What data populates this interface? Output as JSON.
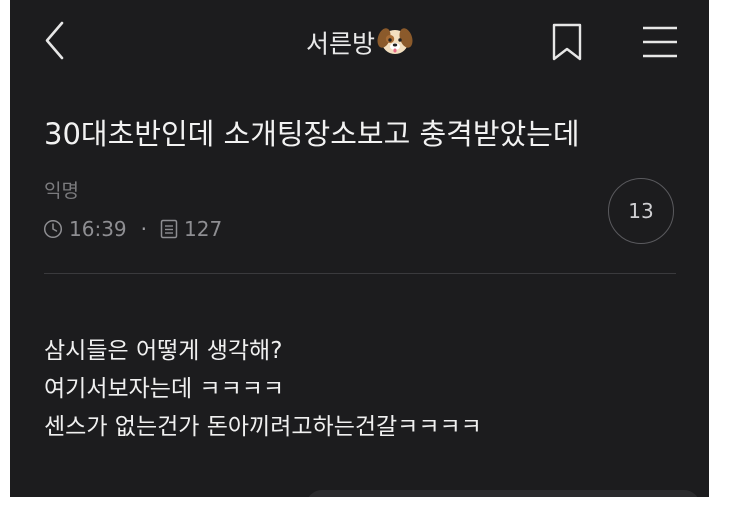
{
  "header": {
    "board_name": "서른방",
    "board_emoji": "🐶",
    "back_icon": "chevron-left-icon",
    "bookmark_icon": "bookmark-icon",
    "menu_icon": "hamburger-menu-icon"
  },
  "post": {
    "title": "30대초반인데 소개팅장소보고 충격받았는데",
    "author": "익명",
    "time": "16:39",
    "views": "127",
    "comment_count": "13",
    "body_lines": [
      "삼시들은 어떻게 생각해?",
      "여기서보자는데 ㅋㅋㅋㅋ",
      "센스가 없는건가 돈아끼려고하는건갈ㅋㅋㅋㅋ"
    ]
  },
  "colors": {
    "background": "#1c1c1e",
    "text": "#f0f0f0",
    "muted": "#8e8e92"
  }
}
